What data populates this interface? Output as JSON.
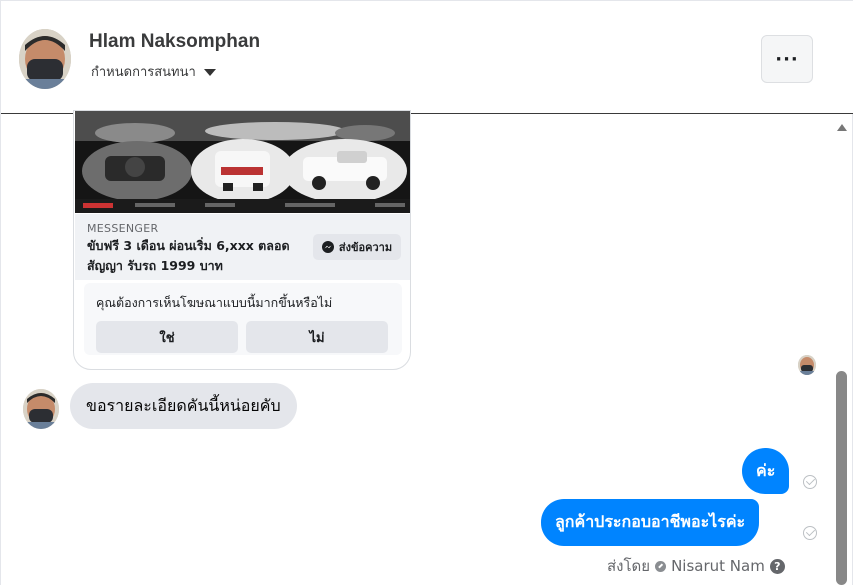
{
  "header": {
    "name": "Hlam Naksomphan",
    "subtitle": "กำหนดการสนทนา",
    "more_label": "···"
  },
  "ad": {
    "source": "MESSENGER",
    "title": "ขับฟรี 3 เดือน ผ่อนเริ่ม 6,xxx ตลอดสัญญา รับรถ 1999 บาท",
    "cta_label": "ส่งข้อความ",
    "cta_icon": "messenger-icon",
    "survey_question": "คุณต้องการเห็นโฆษณาแบบนี้มากขึ้นหรือไม่",
    "survey_yes": "ใช่",
    "survey_no": "ไม่"
  },
  "messages": [
    {
      "direction": "in",
      "text": "ขอรายละเอียดคันนี้หน่อยคับ"
    },
    {
      "direction": "out",
      "text": "ค่ะ",
      "status": "sent-check-icon"
    },
    {
      "direction": "out",
      "text": "ลูกค้าประกอบอาชีพอะไรค่ะ",
      "status": "sent-check-icon"
    }
  ],
  "sent_by": {
    "prefix": "ส่งโดย",
    "name": "Nisarut Nam",
    "help": "?"
  },
  "colors": {
    "outgoing_bubble": "#0084ff",
    "incoming_bubble": "#e4e6eb",
    "scroll_thumb": "#888888"
  }
}
